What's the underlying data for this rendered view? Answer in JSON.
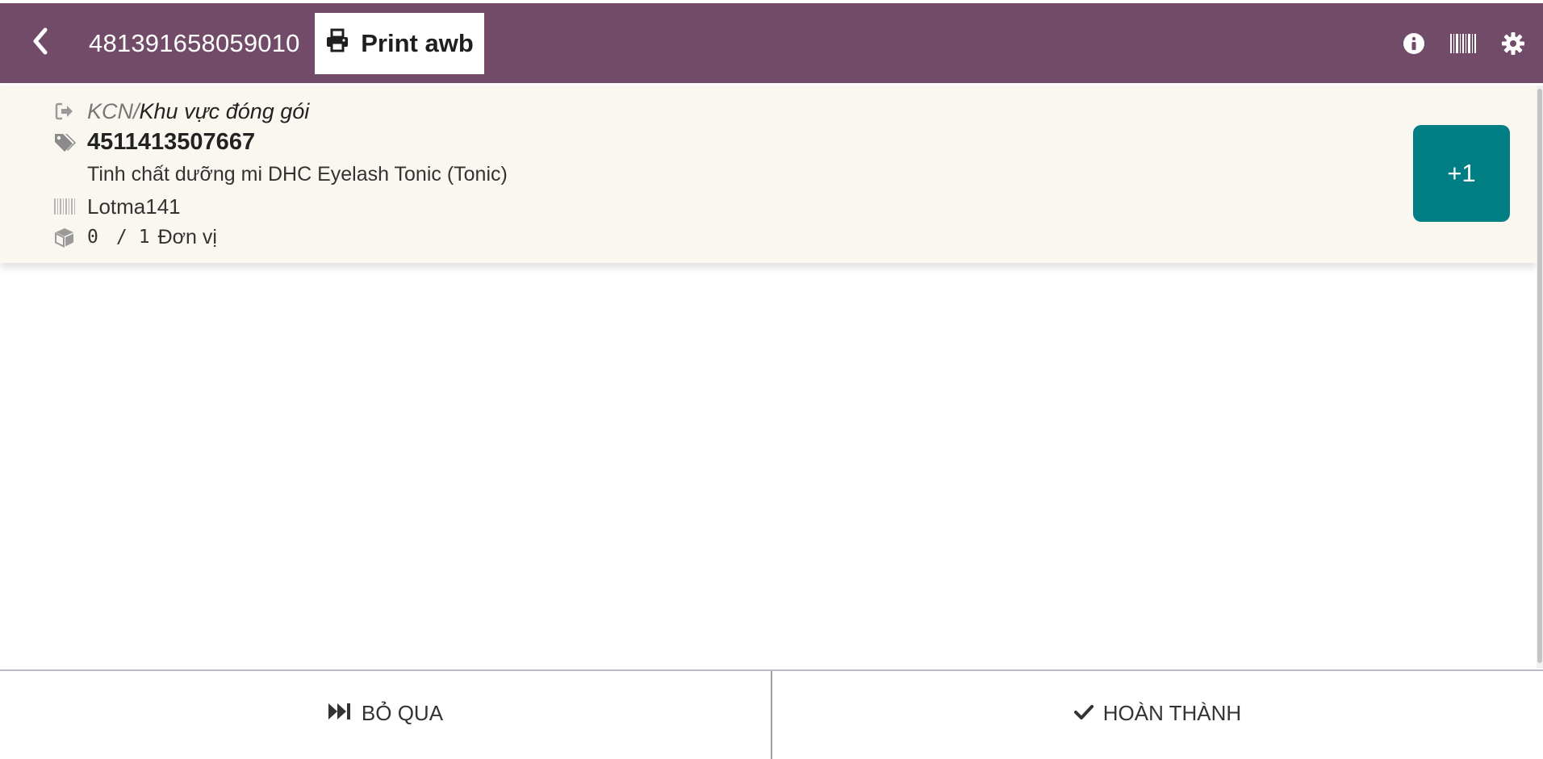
{
  "colors": {
    "brand": "#714B67",
    "accent": "#017E84",
    "card_bg": "#FAF7F0"
  },
  "navbar": {
    "back_icon": "chevron-left-icon",
    "title": "481391658059010",
    "print_button": {
      "icon": "print-icon",
      "label": "Print awb"
    },
    "right_icons": [
      "info-icon",
      "barcode-icon",
      "gear-icon"
    ]
  },
  "line": {
    "location": {
      "icon": "sign-out-icon",
      "source": "KCN",
      "separator": "/",
      "destination": "Khu vực đóng gói"
    },
    "product": {
      "icon": "tags-icon",
      "code": "4511413507667",
      "name": "Tinh chất dưỡng mi DHC Eyelash Tonic (Tonic)"
    },
    "lot": {
      "icon": "barcode-icon",
      "value": "Lotma141"
    },
    "quantity": {
      "icon": "cube-icon",
      "done": "0",
      "separator": "/",
      "demand": "1",
      "unit": "Đơn vị"
    },
    "increment_button": "+1"
  },
  "footer": {
    "skip": {
      "icon": "fast-forward-icon",
      "label": "BỎ QUA"
    },
    "validate": {
      "icon": "check-icon",
      "label": "HOÀN THÀNH"
    }
  }
}
